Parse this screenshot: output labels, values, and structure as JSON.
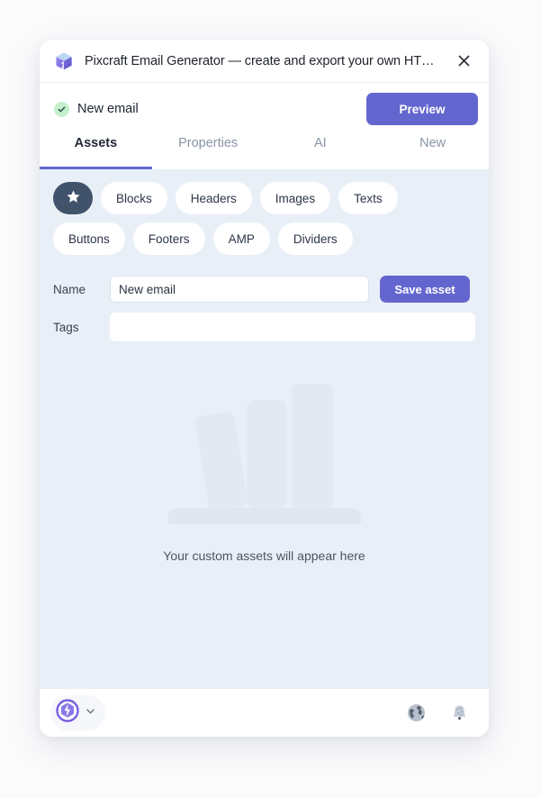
{
  "window": {
    "title": "Pixcraft Email Generator — create and export your own HT…",
    "logo_icon": "cube-logo-icon",
    "close_icon": "close-icon"
  },
  "document": {
    "status_icon": "check-circle-icon",
    "name": "New email",
    "preview_label": "Preview"
  },
  "tabs": [
    {
      "label": "Assets",
      "active": true
    },
    {
      "label": "Properties",
      "active": false
    },
    {
      "label": "AI",
      "active": false
    },
    {
      "label": "New",
      "active": false
    }
  ],
  "categories": [
    {
      "label": "",
      "icon": "star-icon",
      "active": true
    },
    {
      "label": "Blocks",
      "active": false
    },
    {
      "label": "Headers",
      "active": false
    },
    {
      "label": "Images",
      "active": false
    },
    {
      "label": "Texts",
      "active": false
    },
    {
      "label": "Buttons",
      "active": false
    },
    {
      "label": "Footers",
      "active": false
    },
    {
      "label": "AMP",
      "active": false
    },
    {
      "label": "Dividers",
      "active": false
    }
  ],
  "form": {
    "name_label": "Name",
    "name_value": "New email",
    "name_placeholder": "",
    "tags_label": "Tags",
    "tags_value": "",
    "tags_placeholder": "",
    "save_label": "Save asset"
  },
  "empty_state": {
    "illustration": "books-on-shelf-illustration",
    "message": "Your custom assets will appear here"
  },
  "footer": {
    "account_icon": "account-badge-icon",
    "account_chevron_icon": "chevron-down-icon",
    "globe_icon": "globe-icon",
    "bell_icon": "bell-icon"
  },
  "colors": {
    "accent": "#6366cf",
    "panel_bg": "#e9eff7",
    "chip_active_bg": "#41526b",
    "status_green": "#c5f0cd",
    "page_bg": "#fbfbfc"
  }
}
